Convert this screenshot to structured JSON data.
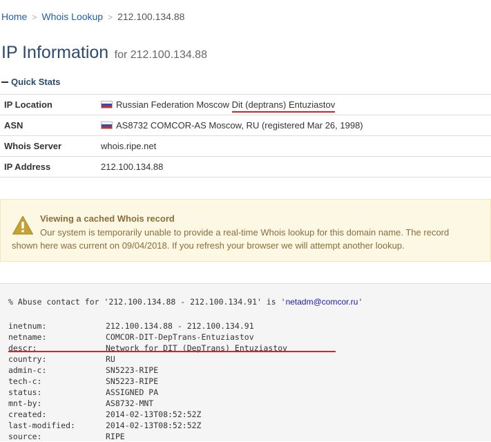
{
  "breadcrumb": {
    "home": "Home",
    "whois": "Whois Lookup",
    "current": "212.100.134.88"
  },
  "title": {
    "main": "IP Information",
    "sub": "for 212.100.134.88"
  },
  "section": {
    "quick_stats": "Quick Stats"
  },
  "stats": [
    {
      "label": "IP Location",
      "value_plain": "Russian Federation Moscow ",
      "value_highlight": "Dit (deptrans) Entuziastov",
      "flag": "ru-flag"
    },
    {
      "label": "ASN",
      "value": "AS8732 COMCOR-AS Moscow, RU (registered Mar 26, 1998)",
      "flag": "ru-flag"
    },
    {
      "label": "Whois Server",
      "value": "whois.ripe.net"
    },
    {
      "label": "IP Address",
      "value": "212.100.134.88"
    }
  ],
  "alert": {
    "title": "Viewing a cached Whois record",
    "line1": "Our system is temporarily unable to provide a real-time Whois lookup for this domain name. The record",
    "line2": "shown here was current on 09/04/2018. If you refresh your browser we will attempt another lookup.",
    "icon": "warning-icon"
  },
  "whois": {
    "abuse_prefix": "% Abuse contact for '212.100.134.88 - 212.100.134.91' is '",
    "abuse_email": "netadm@comcor.ru",
    "abuse_suffix": "'",
    "fields": [
      {
        "k": "inetnum:",
        "v": "212.100.134.88 - 212.100.134.91"
      },
      {
        "k": "netname:",
        "v": "COMCOR-DIT-DepTrans-Entuziastov"
      },
      {
        "k": "descr:",
        "v": "Network for DIT (DepTrans) Entuziastov"
      },
      {
        "k": "country:",
        "v": "RU"
      },
      {
        "k": "admin-c:",
        "v": "SN5223-RIPE"
      },
      {
        "k": "tech-c:",
        "v": "SN5223-RIPE"
      },
      {
        "k": "status:",
        "v": "ASSIGNED PA"
      },
      {
        "k": "mnt-by:",
        "v": "AS8732-MNT"
      },
      {
        "k": "created:",
        "v": "2014-02-13T08:52:52Z"
      },
      {
        "k": "last-modified:",
        "v": "2014-02-13T08:52:52Z"
      },
      {
        "k": "source:",
        "v": "RIPE"
      }
    ]
  },
  "colors": {
    "link": "#1f5fa8",
    "title": "#2b4a6f",
    "alert_bg": "#fcf8e3",
    "alert_text": "#8a6d3b",
    "annotation": "#e02020"
  }
}
